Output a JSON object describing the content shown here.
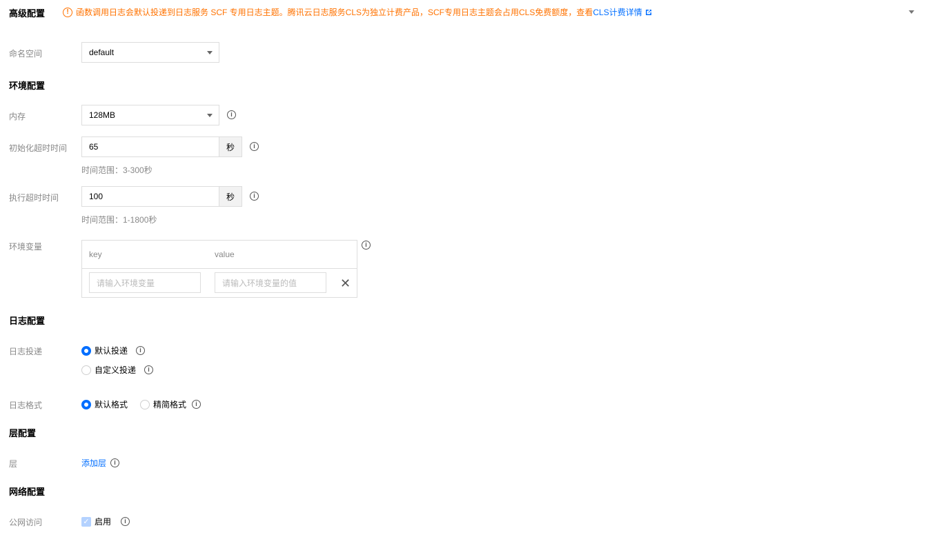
{
  "header": {
    "title": "高级配置",
    "notice": "函数调用日志会默认投递到日志服务 SCF 专用日志主题。腾讯云日志服务CLS为独立计费产品，SCF专用日志主题会占用CLS免费额度，查看",
    "notice_link": "CLS计费详情",
    "colors": {
      "warning": "#ff7200",
      "link": "#006eff"
    }
  },
  "namespace": {
    "label": "命名空间",
    "value": "default"
  },
  "env_section": {
    "title": "环境配置"
  },
  "memory": {
    "label": "内存",
    "value": "128MB"
  },
  "init_timeout": {
    "label": "初始化超时时间",
    "value": "65",
    "unit": "秒",
    "hint": "时间范围：3-300秒"
  },
  "exec_timeout": {
    "label": "执行超时时间",
    "value": "100",
    "unit": "秒",
    "hint": "时间范围：1-1800秒"
  },
  "env_vars": {
    "label": "环境变量",
    "col_key": "key",
    "col_value": "value",
    "key_placeholder": "请输入环境变量",
    "value_placeholder": "请输入环境变量的值"
  },
  "log_section": {
    "title": "日志配置"
  },
  "log_delivery": {
    "label": "日志投递",
    "options": [
      {
        "label": "默认投递",
        "checked": true
      },
      {
        "label": "自定义投递",
        "checked": false
      }
    ]
  },
  "log_format": {
    "label": "日志格式",
    "options": [
      {
        "label": "默认格式",
        "checked": true
      },
      {
        "label": "精简格式",
        "checked": false
      }
    ]
  },
  "layer_section": {
    "title": "层配置"
  },
  "layer": {
    "label": "层",
    "add_link": "添加层"
  },
  "network_section": {
    "title": "网络配置"
  },
  "public_access": {
    "label": "公网访问",
    "checkbox_label": "启用",
    "checked": true
  }
}
